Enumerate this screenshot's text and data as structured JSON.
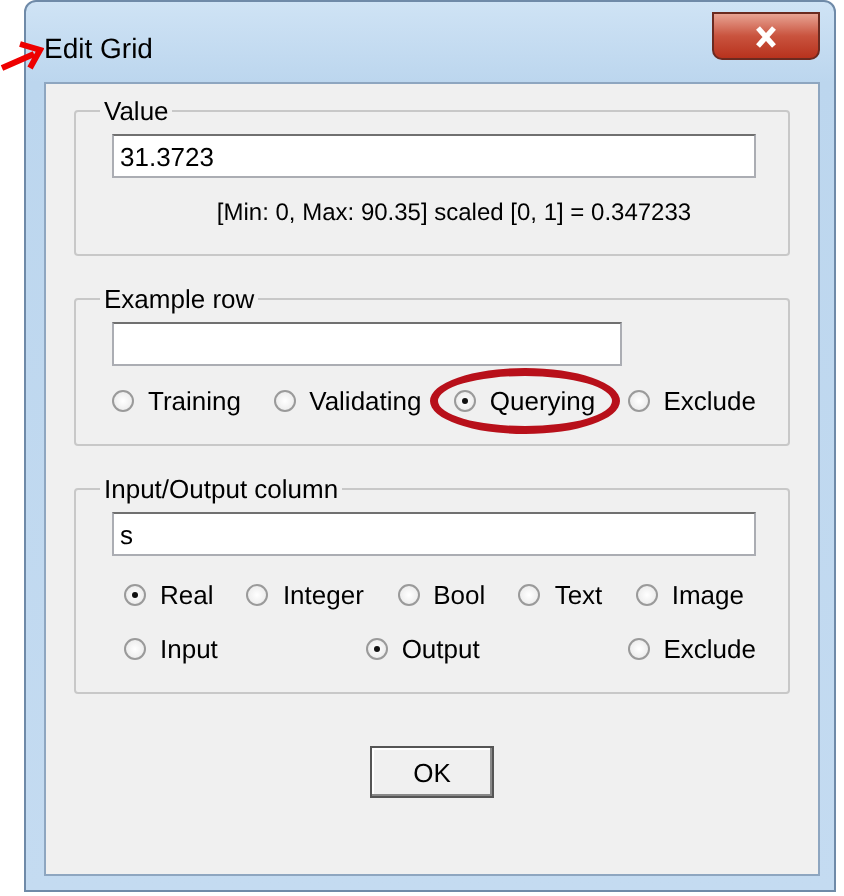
{
  "window": {
    "title": "Edit Grid"
  },
  "value_group": {
    "title": "Value",
    "value": "31.3723",
    "info": "[Min: 0, Max: 90.35] scaled [0, 1] = 0.347233"
  },
  "example_row": {
    "title": "Example row",
    "options": [
      {
        "label": "Training",
        "selected": false,
        "highlighted": false
      },
      {
        "label": "Validating",
        "selected": false,
        "highlighted": false
      },
      {
        "label": "Querying",
        "selected": true,
        "highlighted": true
      },
      {
        "label": "Exclude",
        "selected": false,
        "highlighted": false
      }
    ]
  },
  "io_column": {
    "title": "Input/Output column",
    "value": "s",
    "types": [
      {
        "label": "Real",
        "selected": true
      },
      {
        "label": "Integer",
        "selected": false
      },
      {
        "label": "Bool",
        "selected": false
      },
      {
        "label": "Text",
        "selected": false
      },
      {
        "label": "Image",
        "selected": false
      }
    ],
    "roles": [
      {
        "label": "Input",
        "selected": false
      },
      {
        "label": "Output",
        "selected": true
      },
      {
        "label": "Exclude",
        "selected": false
      }
    ]
  },
  "buttons": [
    "OK"
  ]
}
